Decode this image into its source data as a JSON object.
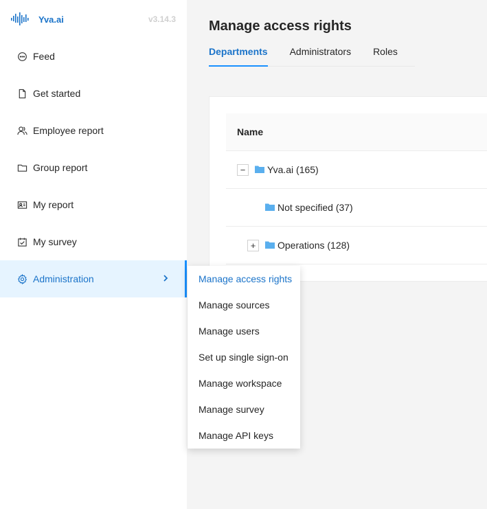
{
  "brand": {
    "name": "Yva.ai",
    "version": "v3.14.3"
  },
  "sidebar": {
    "items": [
      {
        "label": "Feed",
        "icon": "chat-bubble-icon"
      },
      {
        "label": "Get started",
        "icon": "document-icon"
      },
      {
        "label": "Employee report",
        "icon": "users-icon"
      },
      {
        "label": "Group report",
        "icon": "folder-icon"
      },
      {
        "label": "My report",
        "icon": "id-card-icon"
      },
      {
        "label": "My survey",
        "icon": "calendar-check-icon"
      },
      {
        "label": "Administration",
        "icon": "gear-icon",
        "active": true
      }
    ]
  },
  "main": {
    "title": "Manage access rights",
    "tabs": [
      {
        "label": "Departments",
        "active": true
      },
      {
        "label": "Administrators"
      },
      {
        "label": "Roles"
      }
    ],
    "table": {
      "header": "Name",
      "rows": [
        {
          "label": "Yva.ai (165)",
          "expander": "−"
        },
        {
          "label": "Not specified (37)"
        },
        {
          "label": "Operations (128)",
          "expander": "+"
        }
      ]
    }
  },
  "dropdown": {
    "items": [
      {
        "label": "Manage access rights",
        "active": true
      },
      {
        "label": "Manage sources"
      },
      {
        "label": "Manage users"
      },
      {
        "label": "Set up single sign-on"
      },
      {
        "label": "Manage workspace"
      },
      {
        "label": "Manage survey"
      },
      {
        "label": "Manage API keys"
      }
    ]
  },
  "colors": {
    "accent": "#1890ff",
    "accent_text": "#1a73c9",
    "folder": "#5aafee",
    "active_bg": "#e6f4ff"
  }
}
